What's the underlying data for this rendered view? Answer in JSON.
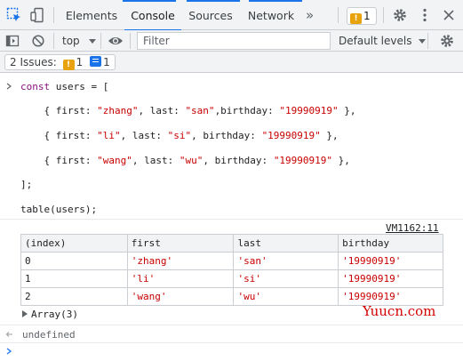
{
  "tabs": {
    "items": [
      {
        "label": "Elements",
        "active": false
      },
      {
        "label": "Console",
        "active": true
      },
      {
        "label": "Sources",
        "active": false
      },
      {
        "label": "Network",
        "active": false
      }
    ],
    "more": "»",
    "issue_count": "1"
  },
  "toolbar": {
    "context": "top",
    "filter_placeholder": "Filter",
    "levels": "Default levels"
  },
  "issues_bar": {
    "label": "2 Issues:",
    "warning_count": "1",
    "info_count": "1"
  },
  "console": {
    "code_lines": [
      "const users = [",
      "    { first: \"zhang\", last: \"san\",birthday: \"19990919\" },",
      "    { first: \"li\", last: \"si\", birthday: \"19990919\" },",
      "    { first: \"wang\", last: \"wu\", birthday: \"19990919\" },",
      "];",
      "table(users);"
    ],
    "source_link": "VM1162:11",
    "table": {
      "headers": [
        "(index)",
        "first",
        "last",
        "birthday"
      ],
      "rows": [
        [
          "0",
          "'zhang'",
          "'san'",
          "'19990919'"
        ],
        [
          "1",
          "'li'",
          "'si'",
          "'19990919'"
        ],
        [
          "2",
          "'wang'",
          "'wu'",
          "'19990919'"
        ]
      ]
    },
    "array_label": "Array(3)",
    "result": "undefined"
  },
  "watermark": "Yuucn.com",
  "colors": {
    "accent": "#1a73e8",
    "string": "#c80000",
    "warning": "#e8a20b"
  },
  "icons": [
    "inspect-element-icon",
    "device-toolbar-icon",
    "warning-icon",
    "gear-icon",
    "kebab-menu-icon",
    "sidebar-toggle-icon",
    "clear-console-icon",
    "eye-icon",
    "chevron-down-icon",
    "console-gear-icon",
    "prompt-icon",
    "collapse-triangle-icon"
  ]
}
